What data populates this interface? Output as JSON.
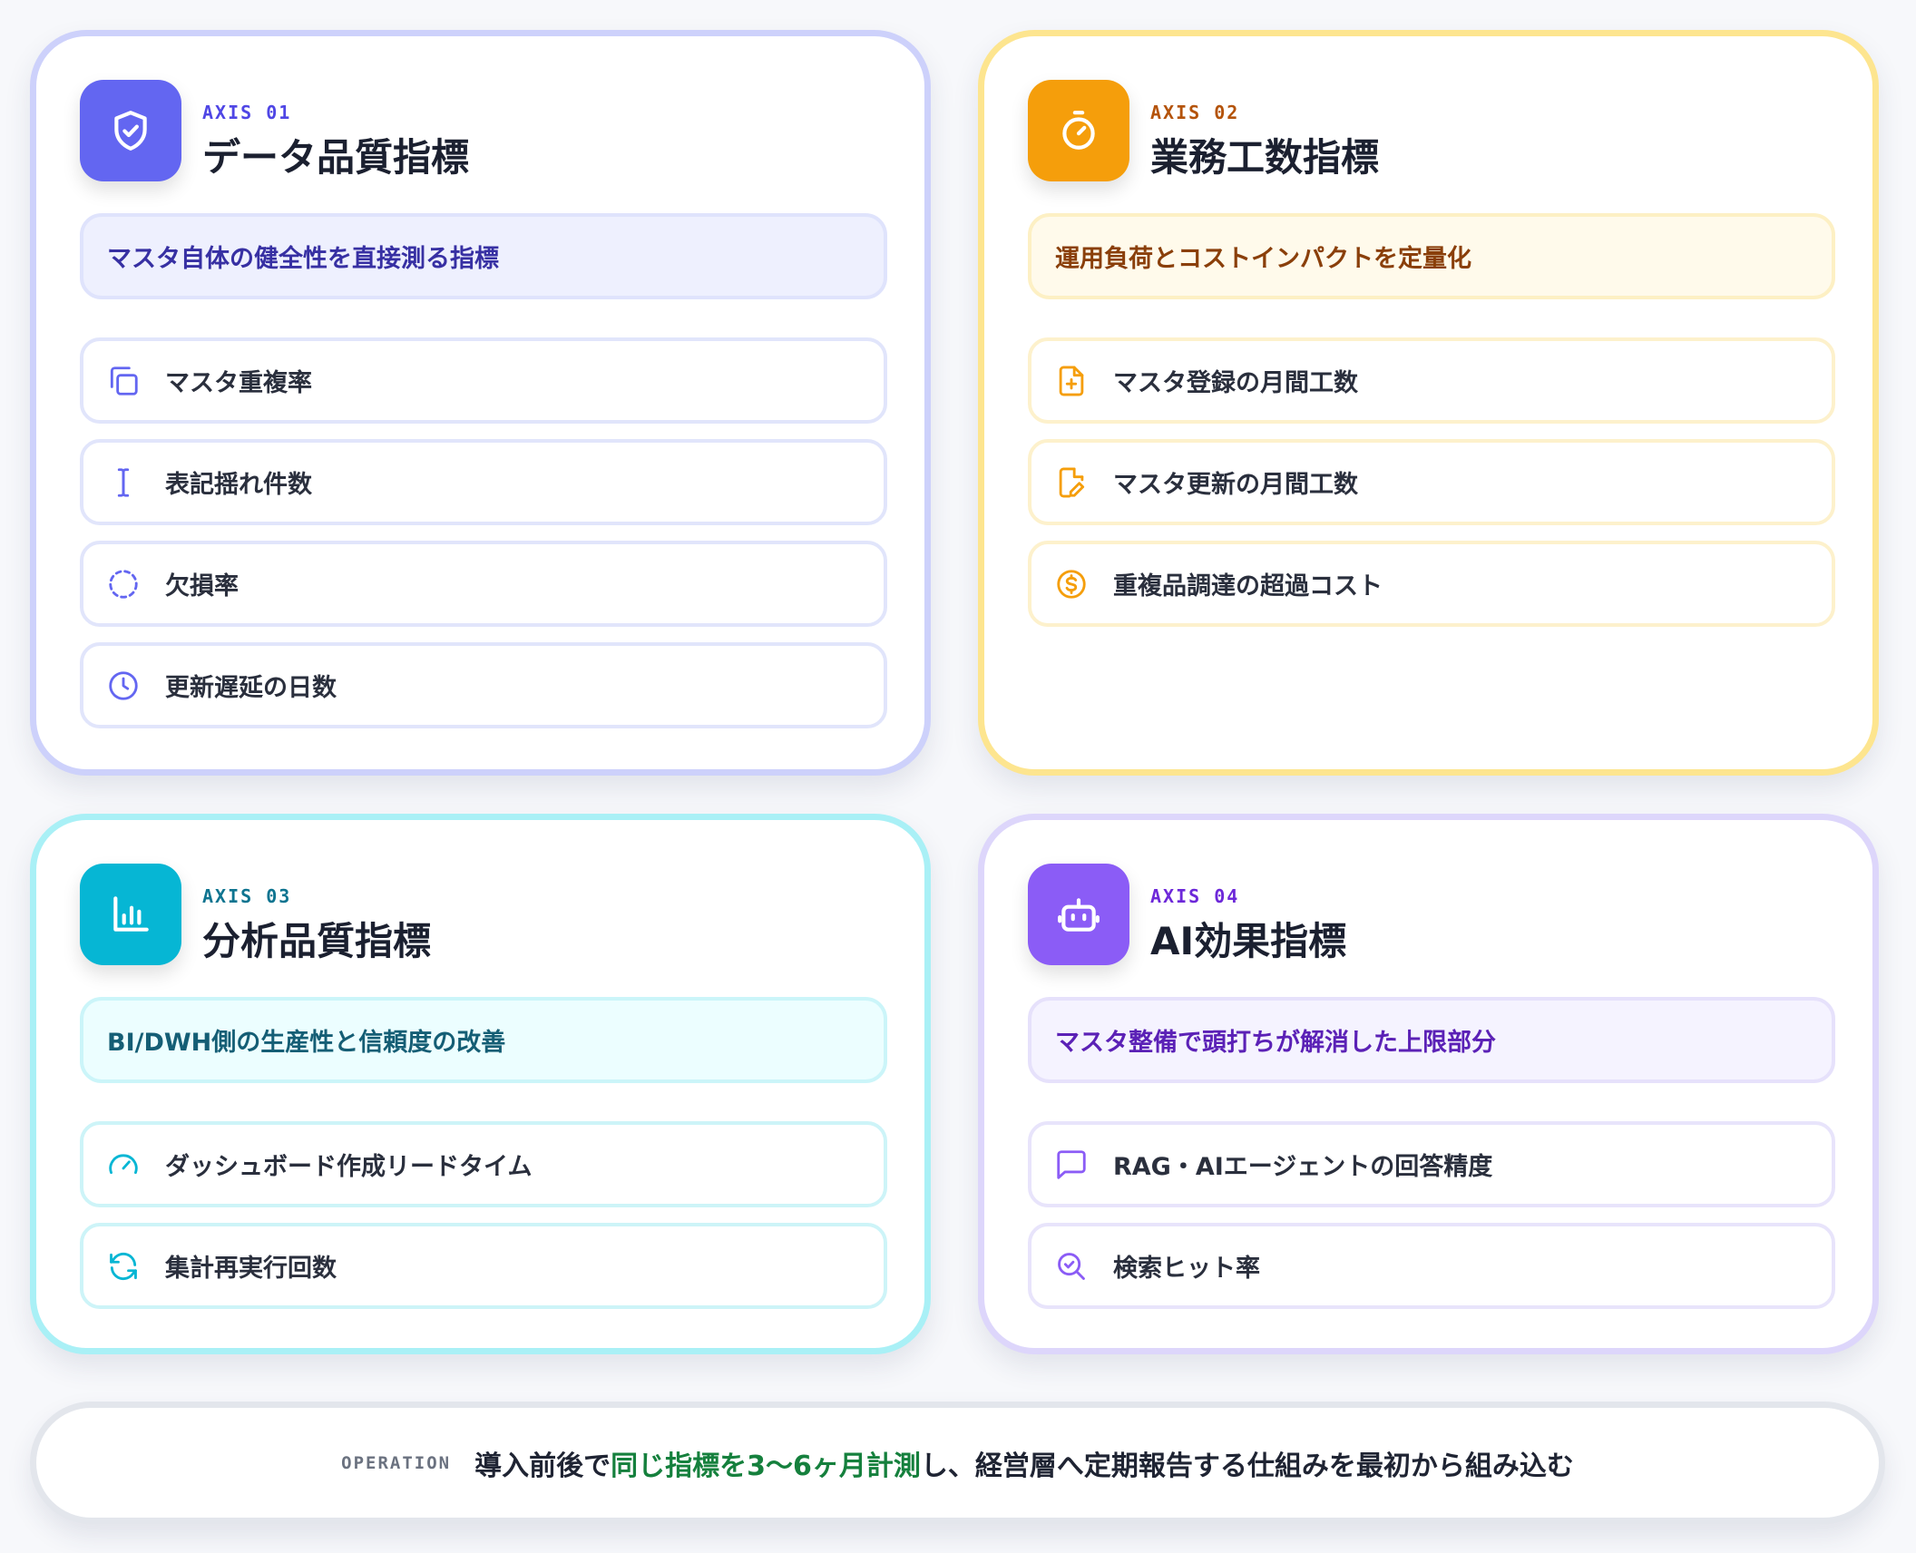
{
  "cards": [
    {
      "axis": "AXIS 01",
      "title": "データ品質指標",
      "subtitle": "マスタ自体の健全性を直接測る指標",
      "icon": "shield-check-icon",
      "accent": "#6366f1",
      "items": [
        {
          "label": "マスタ重複率",
          "icon": "copy-icon"
        },
        {
          "label": "表記揺れ件数",
          "icon": "text-cursor-icon"
        },
        {
          "label": "欠損率",
          "icon": "dashed-circle-icon"
        },
        {
          "label": "更新遅延の日数",
          "icon": "clock-icon"
        }
      ]
    },
    {
      "axis": "AXIS 02",
      "title": "業務工数指標",
      "subtitle": "運用負荷とコストインパクトを定量化",
      "icon": "timer-icon",
      "accent": "#f59e0b",
      "items": [
        {
          "label": "マスタ登録の月間工数",
          "icon": "file-plus-icon"
        },
        {
          "label": "マスタ更新の月間工数",
          "icon": "file-edit-icon"
        },
        {
          "label": "重複品調達の超過コスト",
          "icon": "dollar-circle-icon"
        }
      ]
    },
    {
      "axis": "AXIS 03",
      "title": "分析品質指標",
      "subtitle": "BI/DWH側の生産性と信頼度の改善",
      "icon": "bar-chart-icon",
      "accent": "#06b6d4",
      "items": [
        {
          "label": "ダッシュボード作成リードタイム",
          "icon": "gauge-icon"
        },
        {
          "label": "集計再実行回数",
          "icon": "refresh-icon"
        }
      ]
    },
    {
      "axis": "AXIS 04",
      "title": "AI効果指標",
      "subtitle": "マスタ整備で頭打ちが解消した上限部分",
      "icon": "bot-icon",
      "accent": "#8b5cf6",
      "items": [
        {
          "label": "RAG・AIエージェントの回答精度",
          "icon": "message-square-icon"
        },
        {
          "label": "検索ヒット率",
          "icon": "search-check-icon"
        }
      ]
    }
  ],
  "operation": {
    "label": "OPERATION",
    "text_before": "導入前後で",
    "highlight": "同じ指標を3〜6ヶ月計測",
    "text_after": "し、経営層へ定期報告する仕組みを最初から組み込む",
    "highlight_color": "#15803d"
  }
}
